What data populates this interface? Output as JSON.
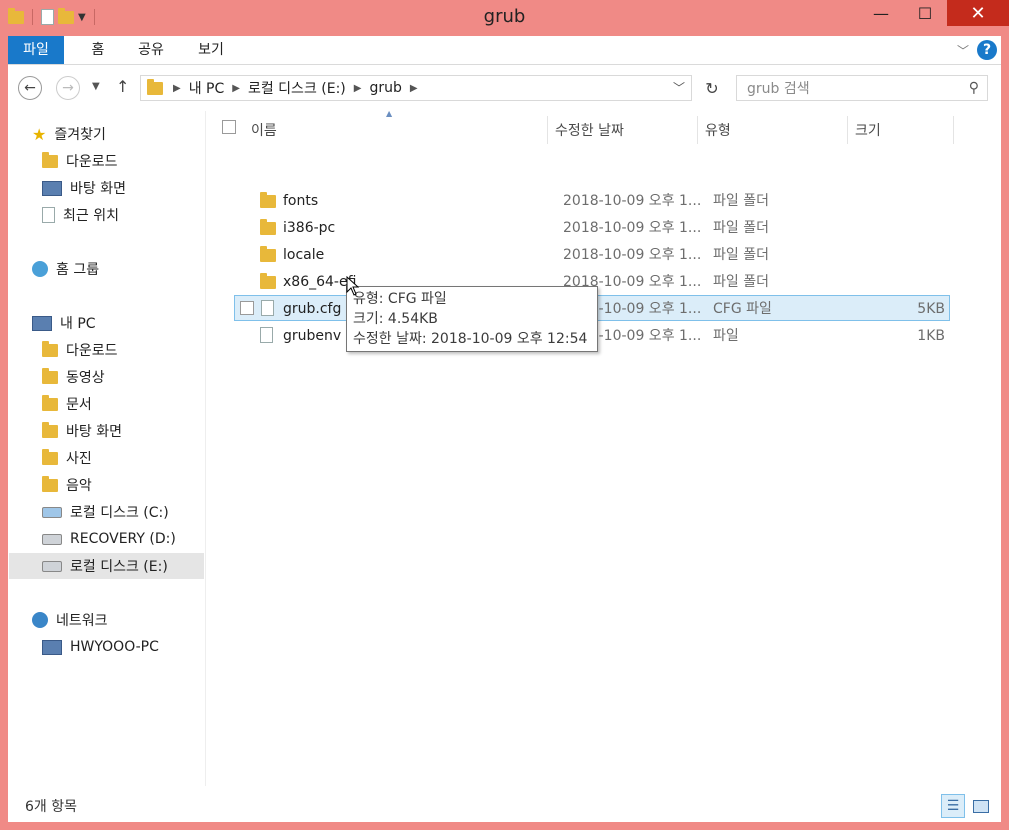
{
  "window": {
    "title": "grub"
  },
  "window_controls": {
    "minimize": "—",
    "maximize": "☐",
    "close": "✕"
  },
  "ribbon": {
    "tabs": [
      "파일",
      "홈",
      "공유",
      "보기"
    ],
    "help": "?"
  },
  "address": {
    "crumbs": [
      "내 PC",
      "로컬 디스크 (E:)",
      "grub"
    ],
    "search_placeholder": "grub 검색"
  },
  "sidebar": {
    "favorites": {
      "label": "즐겨찾기",
      "items": [
        "다운로드",
        "바탕 화면",
        "최근 위치"
      ]
    },
    "homegroup": {
      "label": "홈 그룹"
    },
    "pc": {
      "label": "내 PC",
      "items": [
        "다운로드",
        "동영상",
        "문서",
        "바탕 화면",
        "사진",
        "음악",
        "로컬 디스크 (C:)",
        "RECOVERY (D:)",
        "로컬 디스크 (E:)"
      ]
    },
    "network": {
      "label": "네트워크",
      "items": [
        "HWYOOO-PC"
      ]
    }
  },
  "columns": {
    "name": "이름",
    "date": "수정한 날짜",
    "type": "유형",
    "size": "크기"
  },
  "files": [
    {
      "name": "fonts",
      "date": "2018-10-09 오후 1...",
      "type": "파일 폴더",
      "size": "",
      "kind": "folder"
    },
    {
      "name": "i386-pc",
      "date": "2018-10-09 오후 1...",
      "type": "파일 폴더",
      "size": "",
      "kind": "folder"
    },
    {
      "name": "locale",
      "date": "2018-10-09 오후 1...",
      "type": "파일 폴더",
      "size": "",
      "kind": "folder"
    },
    {
      "name": "x86_64-efi",
      "date": "2018-10-09 오후 1...",
      "type": "파일 폴더",
      "size": "",
      "kind": "folder"
    },
    {
      "name": "grub.cfg",
      "date": "2018-10-09 오후 1...",
      "type": "CFG 파일",
      "size": "5KB",
      "kind": "file"
    },
    {
      "name": "grubenv",
      "date": "2018-10-09 오후 1...",
      "type": "파일",
      "size": "1KB",
      "kind": "file"
    }
  ],
  "tooltip": {
    "type": "유형: CFG 파일",
    "size": "크기: 4.54KB",
    "modified": "수정한 날짜: 2018-10-09 오후 12:54"
  },
  "status": {
    "count": "6개 항목"
  },
  "colors": {
    "titlebar": "#f08a86",
    "accent": "#1979ca",
    "close": "#c42b1c",
    "selection": "#dbedf9"
  }
}
